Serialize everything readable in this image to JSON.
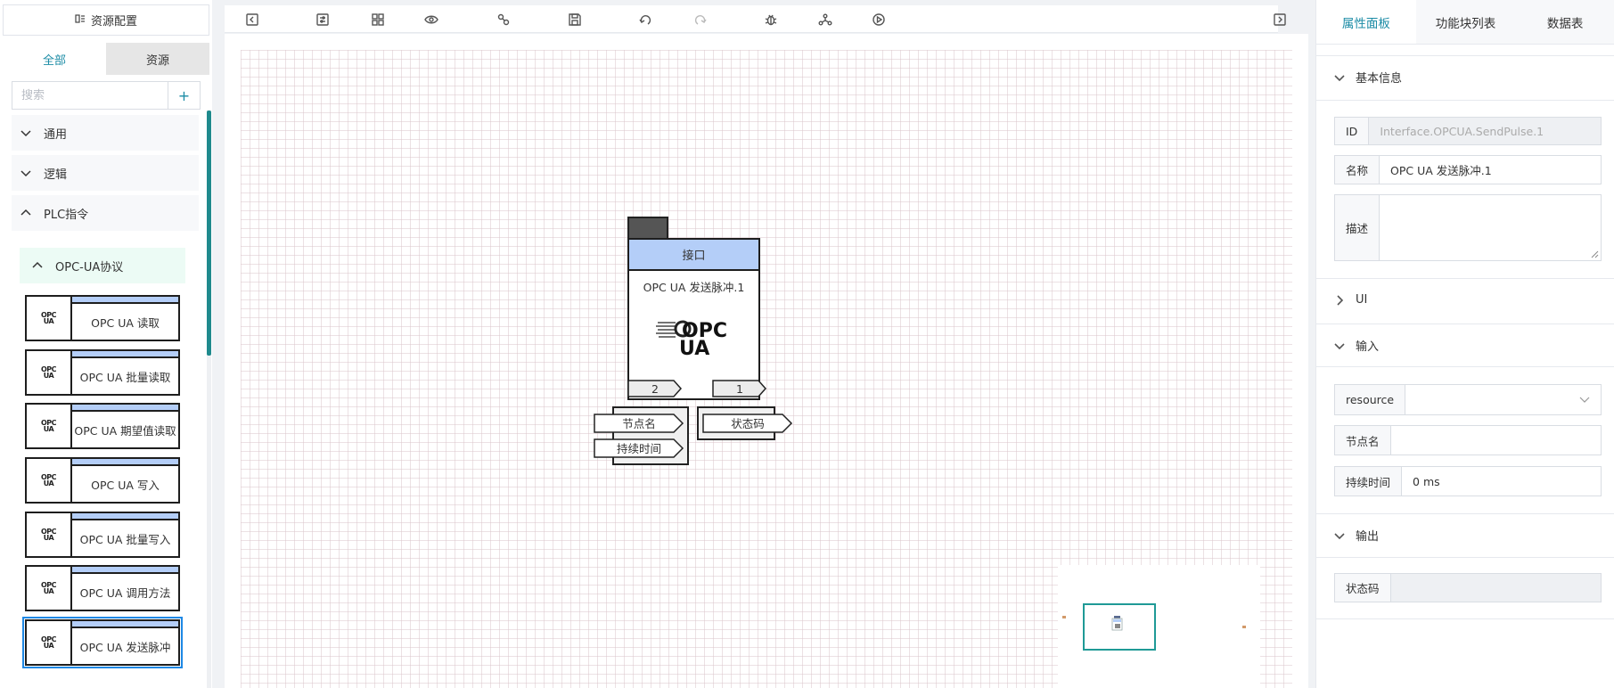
{
  "left_panel": {
    "header_title": "资源配置",
    "tabs": [
      {
        "label": "全部",
        "active": true
      },
      {
        "label": "资源",
        "active": false
      }
    ],
    "search_placeholder": "搜索",
    "add_label": "+",
    "categories": [
      {
        "label": "通用",
        "expanded": false
      },
      {
        "label": "逻辑",
        "expanded": false
      },
      {
        "label": "PLC指令",
        "expanded": true
      }
    ],
    "subcategory": {
      "label": "OPC-UA协议",
      "expanded": true
    },
    "blocks": [
      {
        "label": "OPC UA 读取",
        "icon": "opc-ua-logo-icon"
      },
      {
        "label": "OPC UA 批量读取",
        "icon": "opc-ua-logo-icon"
      },
      {
        "label": "OPC UA 期望值读取",
        "icon": "opc-ua-logo-icon"
      },
      {
        "label": "OPC UA 写入",
        "icon": "opc-ua-logo-icon"
      },
      {
        "label": "OPC UA 批量写入",
        "icon": "opc-ua-logo-icon"
      },
      {
        "label": "OPC UA 调用方法",
        "icon": "opc-ua-logo-icon"
      },
      {
        "label": "OPC UA 发送脉冲",
        "icon": "opc-ua-logo-icon",
        "selected": true
      }
    ],
    "opc_logo_top": "OPC",
    "opc_logo_bottom": "UA"
  },
  "toolbar": {
    "buttons": [
      {
        "icon": "collapse-left-icon"
      },
      {
        "icon": "settings-list-icon"
      },
      {
        "icon": "layout-grid-icon"
      },
      {
        "icon": "preview-eye-icon"
      },
      {
        "icon": "link-icon"
      },
      {
        "icon": "save-icon"
      },
      {
        "icon": "undo-icon"
      },
      {
        "icon": "redo-icon",
        "disabled": true
      },
      {
        "icon": "debug-bug-icon"
      },
      {
        "icon": "share-nodes-icon"
      },
      {
        "icon": "run-play-icon"
      },
      {
        "icon": "collapse-right-icon"
      }
    ]
  },
  "node": {
    "header": "接口",
    "name": "OPC UA 发送脉冲.1",
    "logo_top": "OPC",
    "logo_bottom": "UA",
    "input_count": "2",
    "output_count": "1",
    "inputs": [
      "节点名",
      "持续时间"
    ],
    "outputs": [
      "状态码"
    ]
  },
  "right_panel": {
    "tabs": [
      {
        "label": "属性面板",
        "active": true
      },
      {
        "label": "功能块列表",
        "active": false
      },
      {
        "label": "数据表",
        "active": false
      }
    ],
    "sections": {
      "basic": {
        "title": "基本信息",
        "expanded": true
      },
      "ui": {
        "title": "UI",
        "expanded": false
      },
      "input": {
        "title": "输入",
        "expanded": true
      },
      "output": {
        "title": "输出",
        "expanded": true
      }
    },
    "fields": {
      "id": {
        "label": "ID",
        "value": "Interface.OPCUA.SendPulse.1"
      },
      "name": {
        "label": "名称",
        "value": "OPC UA 发送脉冲.1"
      },
      "desc": {
        "label": "描述",
        "value": ""
      },
      "resource": {
        "label": "resource",
        "value": ""
      },
      "node_name": {
        "label": "节点名",
        "value": ""
      },
      "duration": {
        "label": "持续时间",
        "value": "0 ms"
      },
      "status_code": {
        "label": "状态码",
        "value": ""
      }
    }
  },
  "colors": {
    "accent": "#1c8ca6",
    "block_header": "#b4cef8",
    "minimap_viewport": "#1f9a96",
    "selected_outline": "#1e88e5"
  }
}
